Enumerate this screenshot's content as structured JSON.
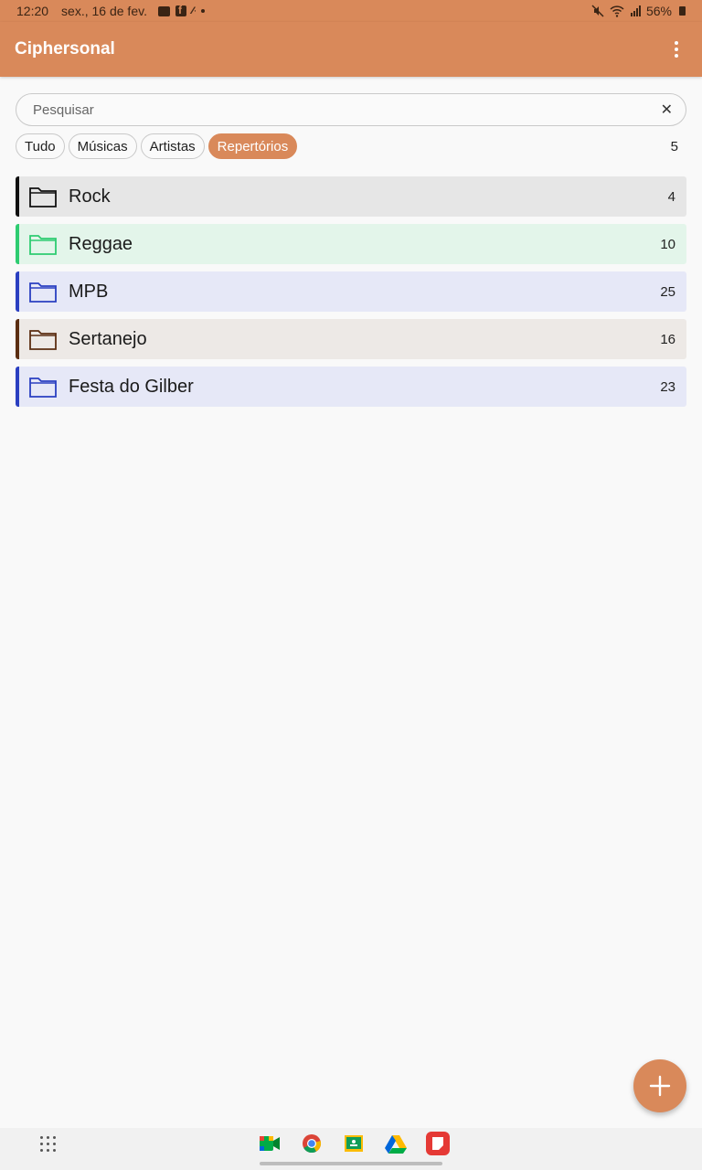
{
  "status_bar": {
    "time": "12:20",
    "date": "sex., 16 de fev.",
    "battery": "56%"
  },
  "app_bar": {
    "title": "Ciphersonal",
    "menu_icon": "more-vert-icon"
  },
  "search": {
    "placeholder": "Pesquisar",
    "value": "",
    "clear_icon": "close-icon"
  },
  "filters": {
    "chips": [
      "Tudo",
      "Músicas",
      "Artistas",
      "Repertórios"
    ],
    "selected": "Repertórios",
    "count": "5"
  },
  "repertoires": [
    {
      "name": "Rock",
      "count": "4",
      "color": "#111111",
      "bg": "#e6e6e6"
    },
    {
      "name": "Reggae",
      "count": "10",
      "color": "#2ecc71",
      "bg": "#e3f5ea"
    },
    {
      "name": "MPB",
      "count": "25",
      "color": "#2a3fc1",
      "bg": "#e6e8f7"
    },
    {
      "name": "Sertanejo",
      "count": "16",
      "color": "#5b2e12",
      "bg": "#ede9e6"
    },
    {
      "name": "Festa do Gilber",
      "count": "23",
      "color": "#2a3fc1",
      "bg": "#e6e8f7"
    }
  ],
  "fab": {
    "icon": "plus-icon"
  },
  "theme": {
    "primary": "#d9895a"
  },
  "taskbar": {
    "apps": [
      "meet-icon",
      "chrome-icon",
      "classroom-icon",
      "drive-icon",
      "keep-icon"
    ]
  }
}
